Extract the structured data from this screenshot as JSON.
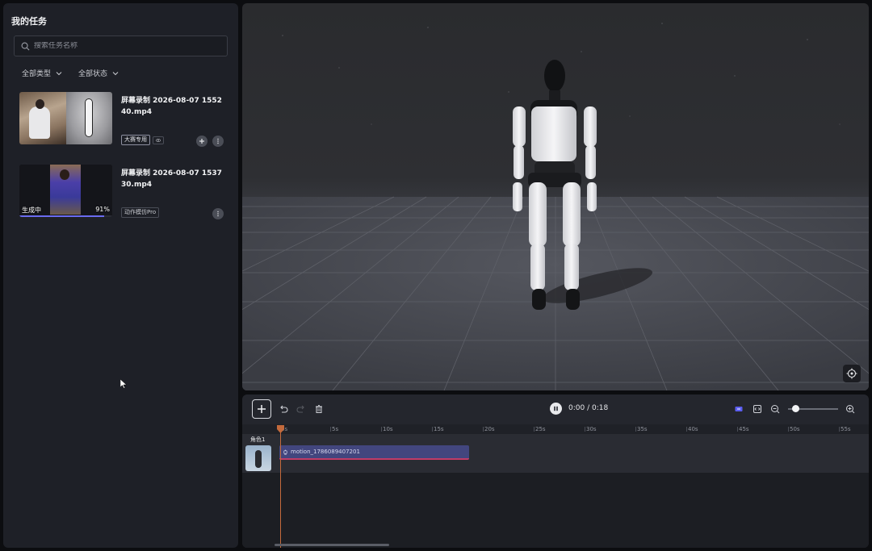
{
  "left_panel": {
    "title": "我的任务",
    "search_placeholder": "搜索任务名称",
    "filters": [
      {
        "label": "全部类型"
      },
      {
        "label": "全部状态"
      }
    ],
    "tasks": [
      {
        "name": "屏幕录制 2026-08-07 155240.mp4",
        "tags": [
          "大赛专用"
        ],
        "status": ""
      },
      {
        "name": "屏幕录制 2026-08-07 153730.mp4",
        "tags": [
          "动作模仿Pro"
        ],
        "status": "生成中",
        "progress_label": "91%",
        "progress": 0.91
      }
    ]
  },
  "viewport": {},
  "timeline": {
    "time_display": "0:00 / 0:18",
    "zoom_level": 0.15,
    "ruler_ticks": [
      "0s",
      "5s",
      "10s",
      "15s",
      "20s",
      "25s",
      "30s",
      "35s",
      "40s",
      "45s",
      "50s",
      "55s"
    ],
    "track": {
      "character_label": "角色1",
      "clip_label": "motion_1786089407201"
    }
  },
  "colors": {
    "accent": "#6a6bf0",
    "clip": "#42467e",
    "clip_border": "#c03c67",
    "playhead": "#c46a3c"
  }
}
